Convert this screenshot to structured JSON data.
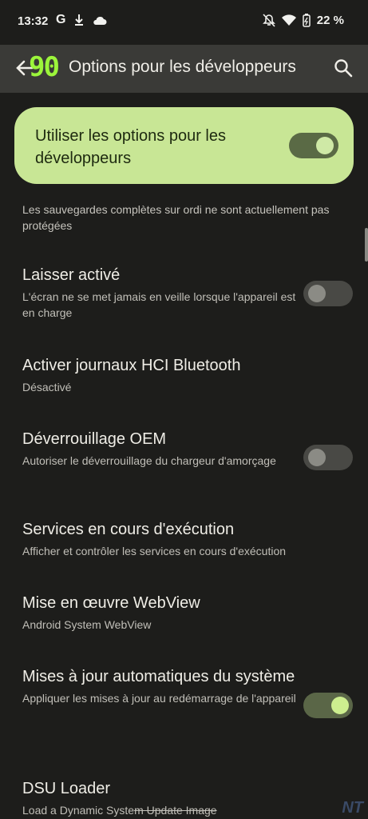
{
  "status": {
    "time": "13:32",
    "left_icons": [
      "google-icon",
      "download-icon",
      "cloud-icon"
    ],
    "right_icons": [
      "mute-icon",
      "wifi-icon",
      "battery-charging-icon"
    ],
    "battery": "22 %"
  },
  "appbar": {
    "fps_overlay": "90",
    "title": "Options pour les développeurs"
  },
  "master": {
    "label": "Utiliser les options pour les développeurs",
    "enabled": true
  },
  "warning": "Les sauvegardes complètes sur ordi ne sont actuellement pas protégées",
  "prefs": [
    {
      "title": "Laisser activé",
      "subtitle": "L'écran ne se met jamais en veille lorsque l'appareil est en charge",
      "toggle": false
    },
    {
      "title": "Activer journaux HCI Bluetooth",
      "subtitle": "Désactivé"
    },
    {
      "title": "Déverrouillage OEM",
      "subtitle": "Autoriser le déverrouillage du chargeur d'amorçage",
      "toggle": false
    },
    {
      "title": "Services en cours d'exécution",
      "subtitle": "Afficher et contrôler les services en cours d'exécution"
    },
    {
      "title": "Mise en œuvre WebView",
      "subtitle": "Android System WebView"
    },
    {
      "title": "Mises à jour automatiques du système",
      "subtitle": "Appliquer les mises à jour au redémarrage de l'appareil",
      "toggle": true
    },
    {
      "title": "DSU Loader",
      "subtitle_a": "Load a Dynamic Syste",
      "subtitle_b": "m Update Image"
    }
  ],
  "watermark": "NT",
  "colors": {
    "accent_card": "#c8e695",
    "background": "#1d1d1b",
    "appbar": "#3a3a37",
    "fps": "#9cf53b"
  }
}
